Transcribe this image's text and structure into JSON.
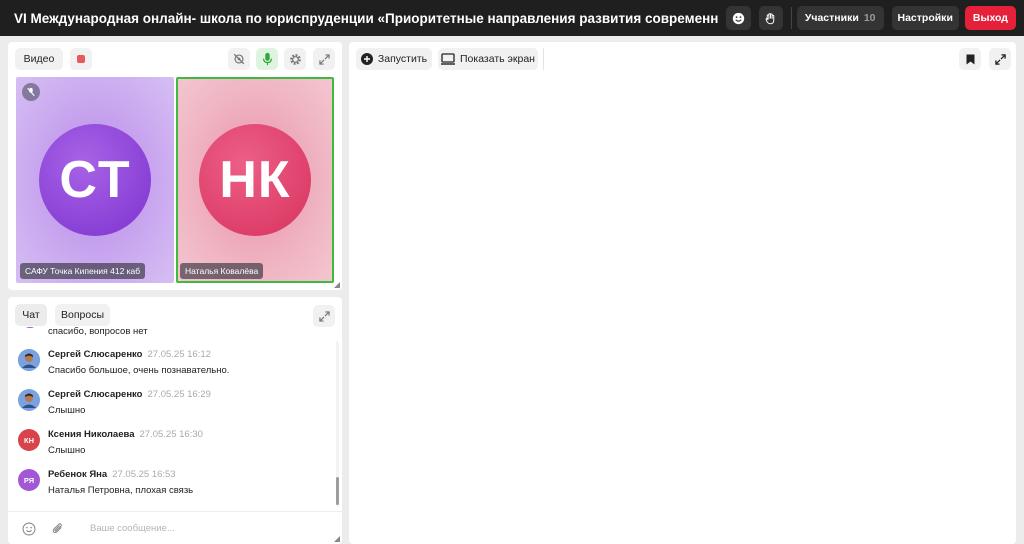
{
  "topbar": {
    "title": "VI Международная онлайн- школа по юриспруденции «Приоритетные направления развития современного пр...",
    "emoji_icon": "smiley-icon",
    "hand_icon": "raise-hand-icon",
    "participants_label": "Участники",
    "participants_count": "10",
    "settings_label": "Настройки",
    "exit_label": "Выход"
  },
  "video": {
    "tab_label": "Видео",
    "tiles": [
      {
        "initials": "CT",
        "name": "САФУ Точка Кипения 412 каб",
        "muted": true
      },
      {
        "initials": "НК",
        "name": "Наталья Ковалёва",
        "speaking": true
      }
    ]
  },
  "chat": {
    "tabs": [
      "Чат",
      "Вопросы"
    ],
    "partial_text": "спасибо, вопросов нет",
    "messages": [
      {
        "author": "Сергей Слюсаренко",
        "time": "27.05.25 16:12",
        "text": "Спасибо большое, очень познавательно.",
        "avatar": "photo"
      },
      {
        "author": "Сергей Слюсаренко",
        "time": "27.05.25 16:29",
        "text": "Слышно",
        "avatar": "photo"
      },
      {
        "author": "Ксения Николаева",
        "time": "27.05.25 16:30",
        "text": "Слышно",
        "avatar_initials": "КН"
      },
      {
        "author": "Ребенок Яна",
        "time": "27.05.25 16:53",
        "text": "Наталья Петровна, плохая связь",
        "avatar_initials": "РЯ"
      }
    ],
    "input_placeholder": "Ваше сообщение..."
  },
  "screen": {
    "start_label": "Запустить",
    "share_label": "Показать экран"
  },
  "colors": {
    "accent_red": "#e5213a",
    "mic_green": "#3dbb3d",
    "topbar_bg": "#1f1f1f"
  }
}
